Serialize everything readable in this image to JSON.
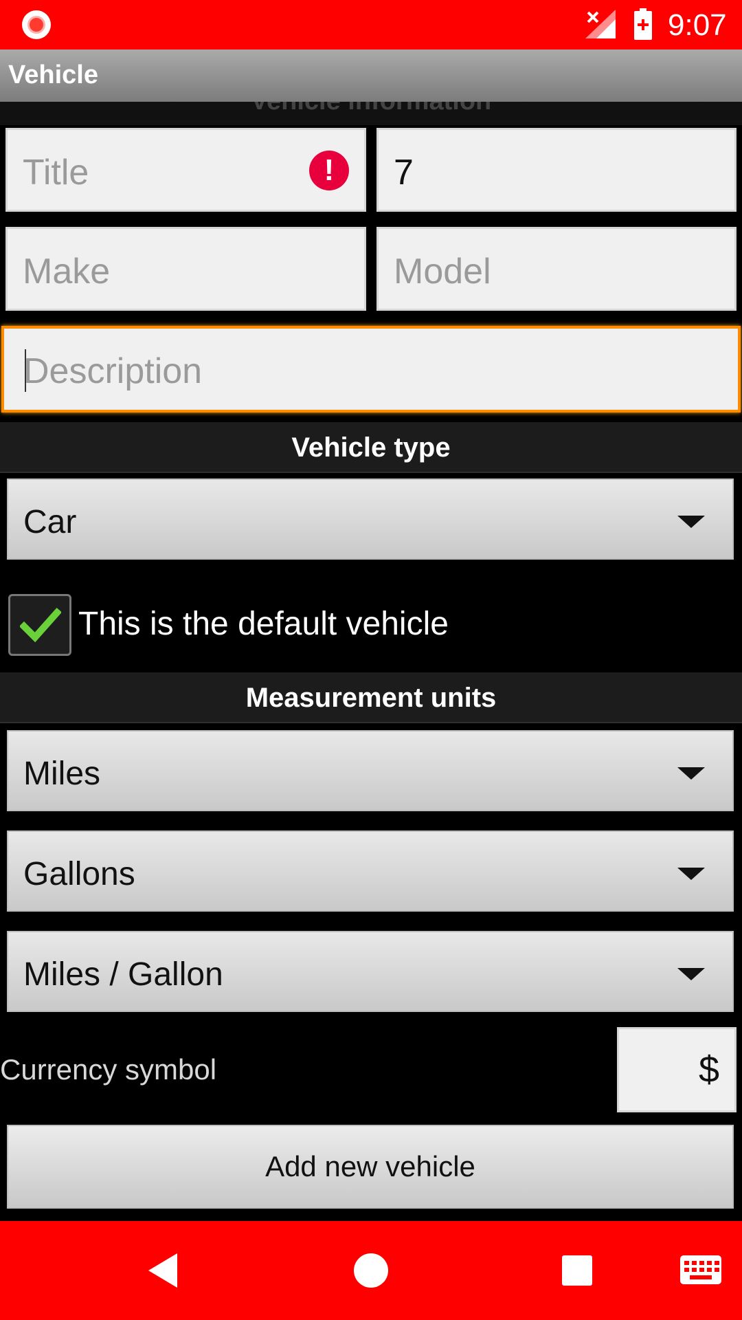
{
  "status_bar": {
    "time": "9:07"
  },
  "titlebar": {
    "title": "Vehicle"
  },
  "section_vehicle_info": {
    "label": "Vehicle information"
  },
  "form": {
    "title_placeholder": "Title",
    "title_error": "!",
    "number_value": "7",
    "make_placeholder": "Make",
    "model_placeholder": "Model",
    "description_placeholder": "Description"
  },
  "vehicle_type": {
    "header": "Vehicle type",
    "selected": "Car"
  },
  "default_vehicle": {
    "label": "This is the default vehicle",
    "checked": true
  },
  "measurement_units": {
    "header": "Measurement units",
    "distance": "Miles",
    "volume": "Gallons",
    "consumption": "Miles / Gallon"
  },
  "currency": {
    "label": "Currency symbol",
    "value": "$"
  },
  "actions": {
    "add_label": "Add new vehicle"
  },
  "colors": {
    "accent": "#ff0000",
    "focus": "#ff8c00",
    "error": "#e8003d",
    "check": "#6bd13a"
  }
}
